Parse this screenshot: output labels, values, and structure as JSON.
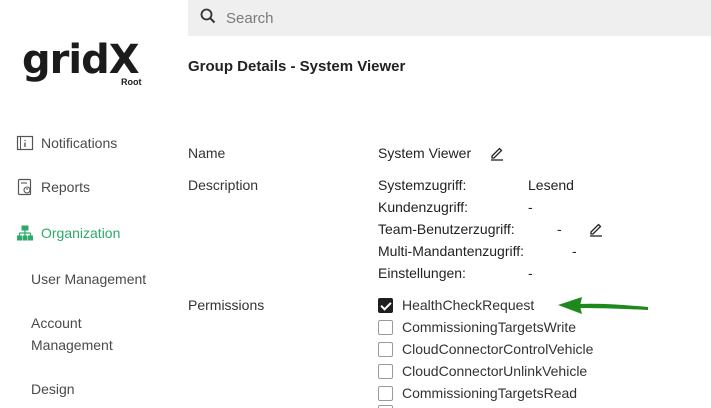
{
  "search": {
    "placeholder": "Search"
  },
  "logo": {
    "wordmark": "gridX",
    "sub": "Root"
  },
  "sidebar": {
    "items": [
      {
        "label": "Notifications",
        "icon": "notifications-icon"
      },
      {
        "label": "Reports",
        "icon": "reports-icon"
      },
      {
        "label": "Organization",
        "icon": "organization-icon",
        "active": true
      }
    ],
    "subitems": [
      {
        "label": "User Management"
      },
      {
        "label": "Account Management"
      },
      {
        "label": "Design"
      }
    ]
  },
  "main": {
    "title": "Group Details - System Viewer",
    "name_label": "Name",
    "name_value": "System Viewer",
    "description_label": "Description",
    "description": [
      {
        "key": "Systemzugriff:",
        "value": "Lesend"
      },
      {
        "key": "Kundenzugriff:",
        "value": "-"
      },
      {
        "key": "Team-Benutzerzugriff:",
        "value": "-"
      },
      {
        "key": "Multi-Mandantenzugriff:",
        "value": "-"
      },
      {
        "key": "Einstellungen:",
        "value": "-"
      }
    ],
    "permissions_label": "Permissions",
    "permissions": [
      {
        "label": "HealthCheckRequest",
        "checked": true
      },
      {
        "label": "CommissioningTargetsWrite",
        "checked": false
      },
      {
        "label": "CloudConnectorControlVehicle",
        "checked": false
      },
      {
        "label": "CloudConnectorUnlinkVehicle",
        "checked": false
      },
      {
        "label": "CommissioningTargetsRead",
        "checked": false
      }
    ]
  },
  "colors": {
    "accent": "#2daa6b",
    "arrow": "#1e8a1e",
    "search_bg": "#efefef"
  }
}
